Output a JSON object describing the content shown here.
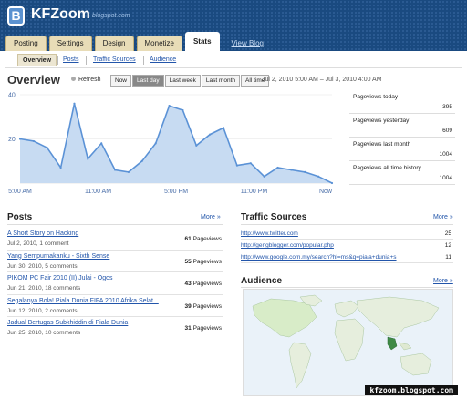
{
  "header": {
    "logo_letter": "B",
    "blog_name": "KFZoom",
    "blog_url": "blogspot.com",
    "tabs": [
      "Posting",
      "Settings",
      "Design",
      "Monetize",
      "Stats"
    ],
    "active_tab": "Stats",
    "view_blog": "View Blog"
  },
  "subnav": {
    "items": [
      "Overview",
      "Posts",
      "Traffic Sources",
      "Audience"
    ],
    "active": "Overview"
  },
  "overview": {
    "title": "Overview",
    "refresh": "Refresh",
    "ranges": [
      "Now",
      "Last day",
      "Last week",
      "Last month",
      "All time"
    ],
    "active_range": "Last day",
    "date_range": "Jul 2, 2010 5:00 AM – Jul 3, 2010 4:00 AM"
  },
  "chart_data": {
    "type": "area",
    "x_ticks": [
      "5:00 AM",
      "11:00 AM",
      "5:00 PM",
      "11:00 PM",
      "Now"
    ],
    "y_ticks": [
      40,
      20
    ],
    "ylim": [
      0,
      40
    ],
    "values": [
      20,
      19,
      16,
      7,
      36,
      11,
      18,
      6,
      5,
      10,
      18,
      35,
      33,
      17,
      22,
      25,
      8,
      9,
      3,
      7,
      6,
      5,
      3,
      0
    ],
    "line_color": "#5b92d6",
    "fill_color": "#c7dbf2"
  },
  "stats": [
    {
      "label": "Pageviews today",
      "value": "395"
    },
    {
      "label": "Pageviews yesterday",
      "value": "609"
    },
    {
      "label": "Pageviews last month",
      "value": "1004"
    },
    {
      "label": "Pageviews all time history",
      "value": "1004"
    }
  ],
  "posts": {
    "title": "Posts",
    "more": "More »",
    "count_label": "Pageviews",
    "items": [
      {
        "title": "A Short Story on Hacking",
        "meta": "Jul 2, 2010, 1 comment",
        "count": "61"
      },
      {
        "title": "Yang Sempurnakanku - Sixth Sense",
        "meta": "Jun 30, 2010, 5 comments",
        "count": "55"
      },
      {
        "title": "PIKOM PC Fair 2010 (II) Julai - Ogos",
        "meta": "Jun 21, 2010, 18 comments",
        "count": "43"
      },
      {
        "title": "Segalanya Bola! Piala Dunia FIFA 2010 Afrika Selat...",
        "meta": "Jun 12, 2010, 2 comments",
        "count": "39"
      },
      {
        "title": "Jadual Bertugas Subkhiddin di Piala Dunia",
        "meta": "Jun 25, 2010, 10 comments",
        "count": "31"
      }
    ]
  },
  "traffic": {
    "title": "Traffic Sources",
    "more": "More »",
    "items": [
      {
        "url": "http://www.twitter.com",
        "count": "25"
      },
      {
        "url": "http://gengblogger.com/popular.php",
        "count": "12"
      },
      {
        "url": "http://www.google.com.my/search?hl=ms&q=piala+dunia+s",
        "count": "11"
      }
    ]
  },
  "audience": {
    "title": "Audience",
    "more": "More »"
  },
  "watermark": "kfzoom.blogspot.com"
}
